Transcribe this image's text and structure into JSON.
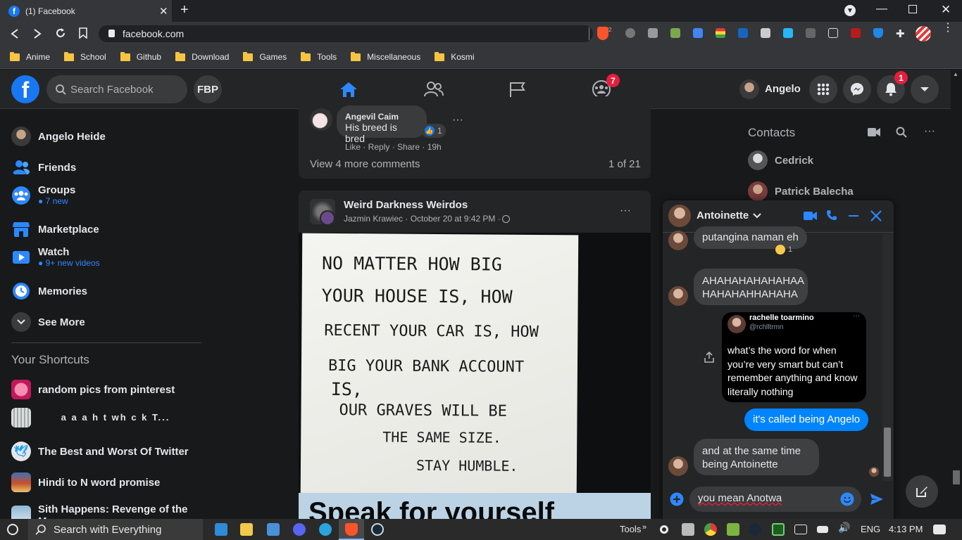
{
  "browser": {
    "tab_title": "(1) Facebook",
    "url": "facebook.com",
    "shields_count": "2",
    "bookmarks": [
      "Anime",
      "School",
      "Github",
      "Download",
      "Games",
      "Tools",
      "Miscellaneous",
      "Kosmi"
    ]
  },
  "header": {
    "search_placeholder": "Search Facebook",
    "fbp_label": "FBP",
    "groups_badge": "7",
    "profile_name": "Angelo",
    "notifications_badge": "1"
  },
  "left_nav": {
    "profile": "Angelo Heide",
    "items": [
      {
        "label": "Friends",
        "sub": ""
      },
      {
        "label": "Groups",
        "sub": "7 new"
      },
      {
        "label": "Marketplace",
        "sub": ""
      },
      {
        "label": "Watch",
        "sub": "9+ new videos"
      },
      {
        "label": "Memories",
        "sub": ""
      },
      {
        "label": "See More",
        "sub": ""
      }
    ],
    "shortcuts_title": "Your Shortcuts",
    "shortcuts": [
      "random pics from pinterest",
      "a a a h t wh c k T...",
      "The Best and Worst Of Twitter",
      "Hindi to N word promise",
      "Sith Happens: Revenge of the Memes"
    ]
  },
  "feed": {
    "comment_author": "Angevil Caim",
    "comment_text": "His breed is bred",
    "comment_reactions": "1",
    "comment_actions": "Like · Reply · Share · 19h",
    "view_more": "View 4 more comments",
    "pagination": "1 of 21",
    "post_group": "Weird Darkness Weirdos",
    "post_author_time": "Jazmin Krawiec · October 20 at 9:42 PM · ",
    "sign_lines": [
      "NO MATTER HOW BIG",
      "YOUR HOUSE IS, HOW",
      "RECENT YOUR CAR IS, HOW",
      "BIG YOUR BANK ACCOUNT",
      "IS,",
      "OUR GRAVES WILL BE",
      "THE SAME SIZE.",
      "STAY HUMBLE."
    ],
    "caption": "Speak for yourself"
  },
  "contacts": {
    "title": "Contacts",
    "list": [
      "Cedrick",
      "Patrick Balecha"
    ]
  },
  "chat": {
    "name": "Antoinette",
    "messages": [
      {
        "text": "putangina naman eh",
        "from": "them",
        "reaction": "1"
      },
      {
        "text": "AHAHAHAHAHAHAA HAHAHAHHAHAHA",
        "from": "them"
      },
      {
        "text": "it's called being Angelo",
        "from": "me"
      },
      {
        "text": "and at the same time being Antoinette",
        "from": "them"
      }
    ],
    "tweet": {
      "name": "rachelle toarmino",
      "handle": "@rchlltrmn",
      "text": "what’s the word for when you’re very smart but can’t remember anything and know literally nothing"
    },
    "input_value": "you mean Anotwa"
  },
  "taskbar": {
    "search_text": "Search with Everything",
    "tools_label": "Tools",
    "language": "ENG",
    "time": "4:13 PM"
  },
  "colors": {
    "accent": "#1877f2",
    "badge": "#e41e3f",
    "bg": "#18191a",
    "surface": "#242526"
  }
}
